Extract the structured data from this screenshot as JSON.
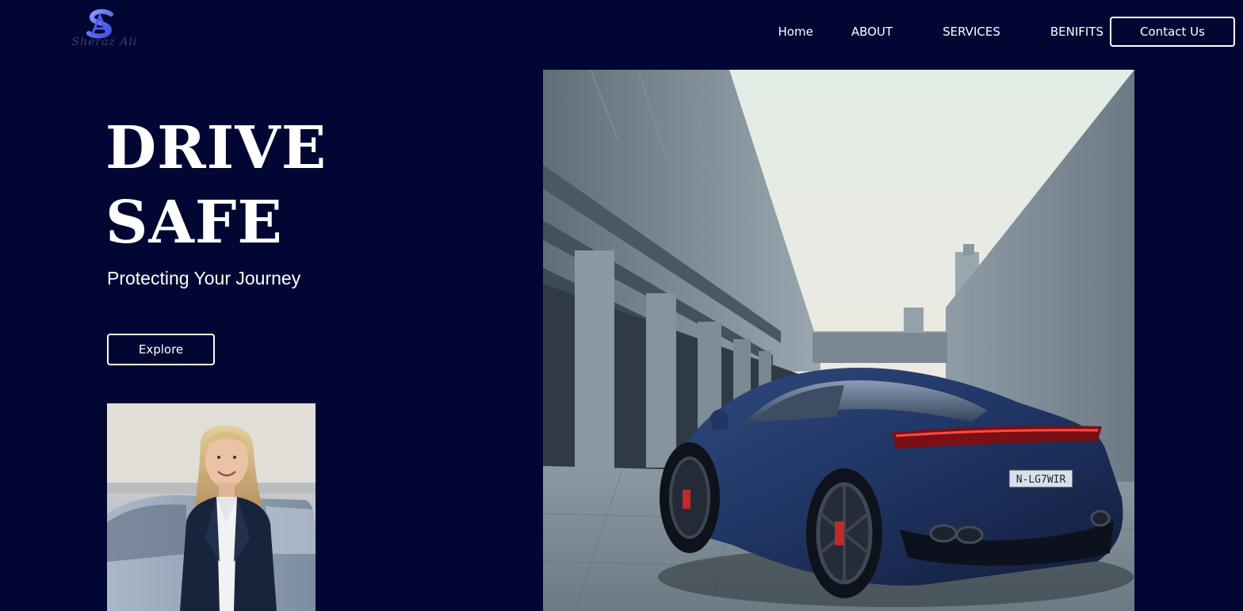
{
  "header": {
    "logo_text": "Sheraz Ali",
    "nav": {
      "home": "Home",
      "about": "ABOUT",
      "services": "SERVICES",
      "benifits": "BENIFITS"
    },
    "contact_label": "Contact Us"
  },
  "hero": {
    "title_line1": "DRIVE",
    "title_line2": "SAFE",
    "subtitle": "Protecting Your Journey",
    "explore_label": "Explore"
  },
  "car_photo": {
    "plate": "N-LG7WIR"
  },
  "colors": {
    "background": "#020632",
    "text": "#ffffff",
    "logo_accent": "#5a6ef5"
  }
}
